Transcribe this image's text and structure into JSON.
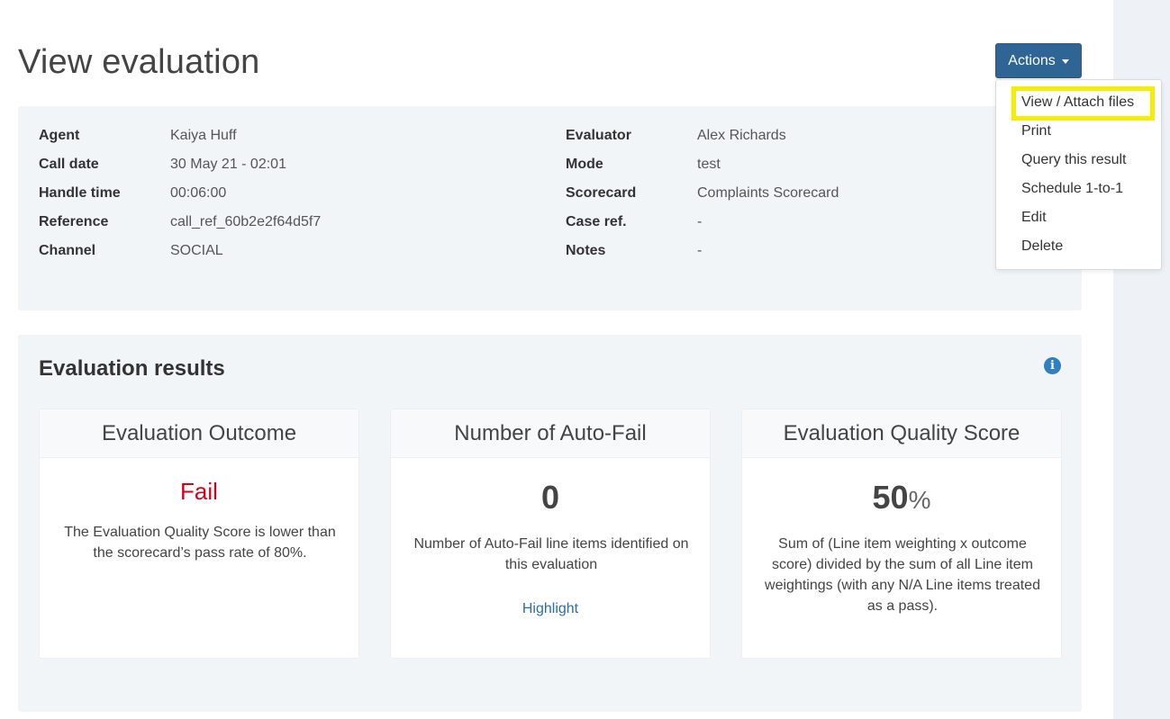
{
  "page": {
    "title": "View evaluation"
  },
  "actions": {
    "button_label": "Actions",
    "menu": [
      "View / Attach files",
      "Print",
      "Query this result",
      "Schedule 1-to-1",
      "Edit",
      "Delete"
    ]
  },
  "details": {
    "left": [
      {
        "label": "Agent",
        "value": "Kaiya Huff"
      },
      {
        "label": "Call date",
        "value": "30 May 21 - 02:01"
      },
      {
        "label": "Handle time",
        "value": "00:06:00"
      },
      {
        "label": "Reference",
        "value": "call_ref_60b2e2f64d5f7"
      },
      {
        "label": "Channel",
        "value": "SOCIAL"
      }
    ],
    "right": [
      {
        "label": "Evaluator",
        "value": "Alex Richards"
      },
      {
        "label": "Mode",
        "value": "test"
      },
      {
        "label": "Scorecard",
        "value": "Complaints Scorecard"
      },
      {
        "label": "Case ref.",
        "value": "-"
      },
      {
        "label": "Notes",
        "value": "-"
      }
    ]
  },
  "results": {
    "title": "Evaluation results",
    "info_icon": "info-icon",
    "cards": [
      {
        "header": "Evaluation Outcome",
        "value": "Fail",
        "description": "The Evaluation Quality Score is lower than the scorecard’s pass rate of 80%."
      },
      {
        "header": "Number of Auto-Fail",
        "value": "0",
        "description": "Number of Auto-Fail line items identified on this evaluation",
        "link": "Highlight"
      },
      {
        "header": "Evaluation Quality Score",
        "value": "50",
        "unit": "%",
        "description": "Sum of (Line item weighting x outcome score) divided by the sum of all Line item weightings (with any N/A Line items treated as a pass)."
      }
    ]
  },
  "colors": {
    "primary_button": "#2f6594",
    "fail": "#d0021b",
    "link": "#2a6ea6",
    "highlight_box": "#f5ee00",
    "panel_bg": "#f2f5f8"
  }
}
